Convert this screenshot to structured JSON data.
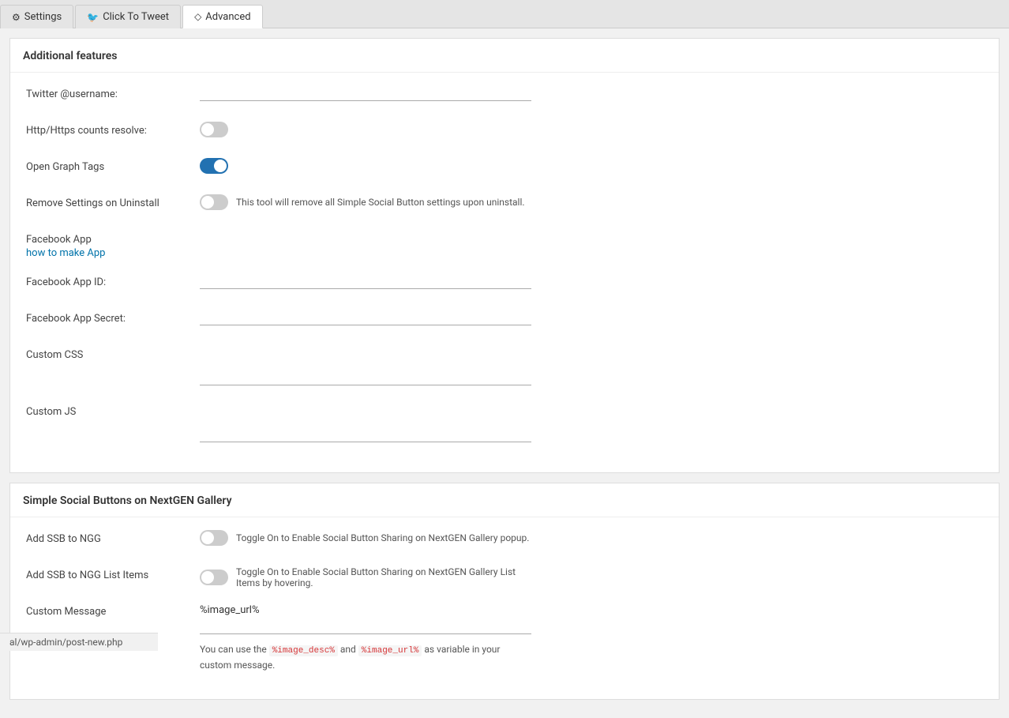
{
  "tabs": [
    {
      "id": "settings",
      "label": "Settings",
      "icon": "⚙",
      "active": false
    },
    {
      "id": "click-to-tweet",
      "label": "Click To Tweet",
      "icon": "🐦",
      "active": false
    },
    {
      "id": "advanced",
      "label": "Advanced",
      "icon": "◇",
      "active": true
    }
  ],
  "section1": {
    "title": "Additional features",
    "fields": {
      "twitter_username_label": "Twitter @username:",
      "twitter_username_placeholder": "",
      "http_counts_label": "Http/Https counts resolve:",
      "http_counts_checked": false,
      "open_graph_label": "Open Graph Tags",
      "open_graph_checked": true,
      "remove_settings_label": "Remove Settings on Uninstall",
      "remove_settings_checked": false,
      "remove_settings_desc": "This tool will remove all Simple Social Button settings upon uninstall.",
      "fb_app_label": "Facebook App",
      "fb_app_link_text": "how to make App",
      "fb_app_id_label": "Facebook App ID:",
      "fb_app_secret_label": "Facebook App Secret:",
      "custom_css_label": "Custom CSS",
      "custom_js_label": "Custom JS"
    }
  },
  "section2": {
    "title": "Simple Social Buttons on NextGEN Gallery",
    "fields": {
      "add_ssb_ngg_label": "Add SSB to NGG",
      "add_ssb_ngg_checked": false,
      "add_ssb_ngg_desc": "Toggle On to Enable Social Button Sharing on NextGEN Gallery popup.",
      "add_ssb_ngg_list_label": "Add SSB to NGG List Items",
      "add_ssb_ngg_list_checked": false,
      "add_ssb_ngg_list_desc": "Toggle On to Enable Social Button Sharing on NextGEN Gallery List Items by hovering.",
      "custom_message_label": "Custom Message",
      "custom_message_value": "%image_url%",
      "hint_text_before": "You can use the ",
      "hint_code1": "%image_desc%",
      "hint_text_mid": " and ",
      "hint_code2": "%image_url%",
      "hint_text_after": " as variable in your custom message."
    }
  },
  "status_bar": {
    "url": "al/wp-admin/post-new.php"
  }
}
